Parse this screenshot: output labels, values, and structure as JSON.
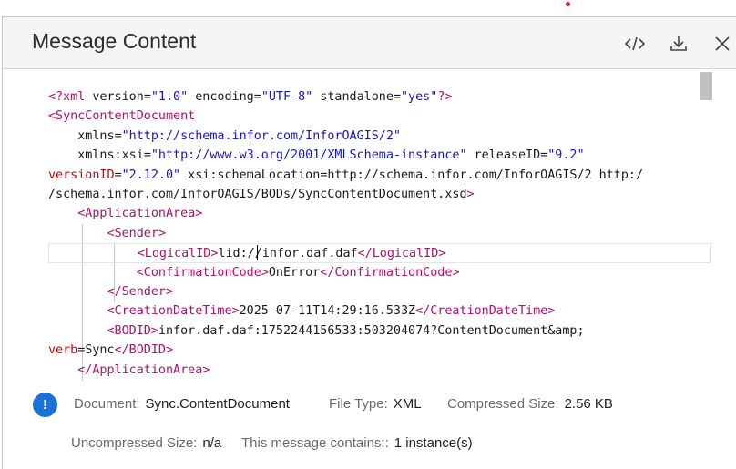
{
  "dialog": {
    "title": "Message Content",
    "actions": {
      "code_view": "code-view",
      "download": "download",
      "close": "close"
    }
  },
  "xml_lines": [
    "<?xml version=\"1.0\" encoding=\"UTF-8\" standalone=\"yes\"?>",
    "<SyncContentDocument",
    "    xmlns=\"http://schema.infor.com/InforOAGIS/2\"",
    "    xmlns:xsi=\"http://www.w3.org/2001/XMLSchema-instance\" releaseID=\"9.2\"",
    "versionID=\"2.12.0\" xsi:schemaLocation=\"http://schema.infor.com/InforOAGIS/2 http:/",
    "/schema.infor.com/InforOAGIS/BODs/SyncContentDocument.xsd\">",
    "    <ApplicationArea>",
    "        <Sender>",
    "            <LogicalID>lid://infor.daf.daf</LogicalID>",
    "            <ConfirmationCode>OnError</ConfirmationCode>",
    "        </Sender>",
    "        <CreationDateTime>2025-07-11T14:29:16.533Z</CreationDateTime>",
    "        <BODID>infor.daf.daf:1752244156533:503204074?ContentDocument&amp;",
    "verb=Sync</BODID>",
    "    </ApplicationArea>"
  ],
  "meta": {
    "document_label": "Document:",
    "document_value": "Sync.ContentDocument",
    "filetype_label": "File Type:",
    "filetype_value": "XML",
    "compressed_label": "Compressed Size:",
    "compressed_value": "2.56 KB",
    "uncompressed_label": "Uncompressed Size:",
    "uncompressed_value": "n/a",
    "contains_label": "This message contains::",
    "contains_value": "1 instance(s)"
  },
  "colors": {
    "tag": "#b0106a",
    "attr": "#d10000",
    "value": "#1616c8",
    "info": "#1a72d6"
  },
  "icons": [
    "code-icon",
    "download-icon",
    "close-icon",
    "info-icon"
  ]
}
